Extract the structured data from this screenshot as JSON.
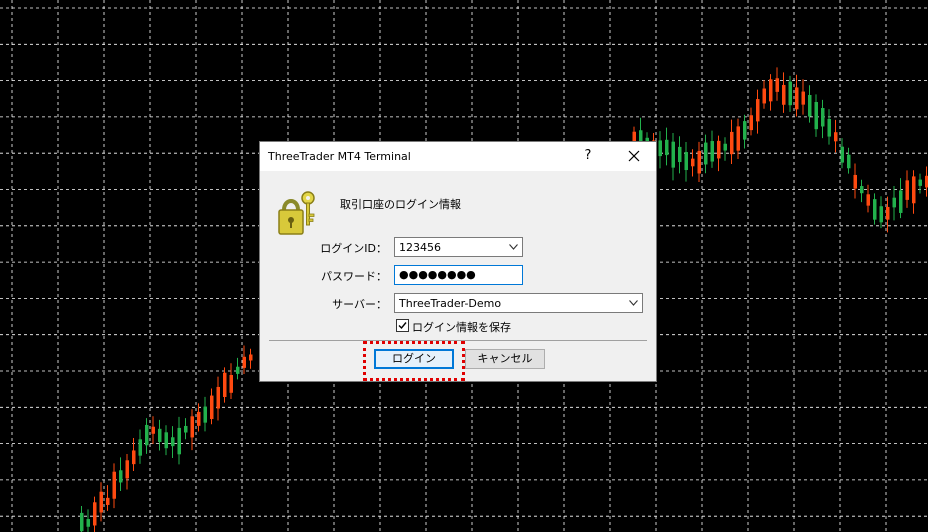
{
  "dialog": {
    "title": "ThreeTrader MT4 Terminal",
    "help_label": "?",
    "header_text": "取引口座のログイン情報",
    "login_label": "ログインID：",
    "login_value": "123456",
    "password_label": "パスワード：",
    "password_value": "●●●●●●●●",
    "server_label": "サーバー：",
    "server_value": "ThreeTrader-Demo",
    "save_label": "ログイン情報を保存",
    "save_checked": true,
    "login_button": "ログイン",
    "cancel_button": "キャンセル"
  },
  "icons": {
    "close": "close-icon",
    "keys": "lock-keys-icon",
    "dropdown": "chevron-down-icon",
    "check": "check-icon"
  },
  "colors": {
    "chart_bg": "#000000",
    "grid": "#ffffff",
    "bull": "#22b14c",
    "bear": "#ff4a10",
    "focus": "#0078d7",
    "highlight": "#e00000"
  }
}
